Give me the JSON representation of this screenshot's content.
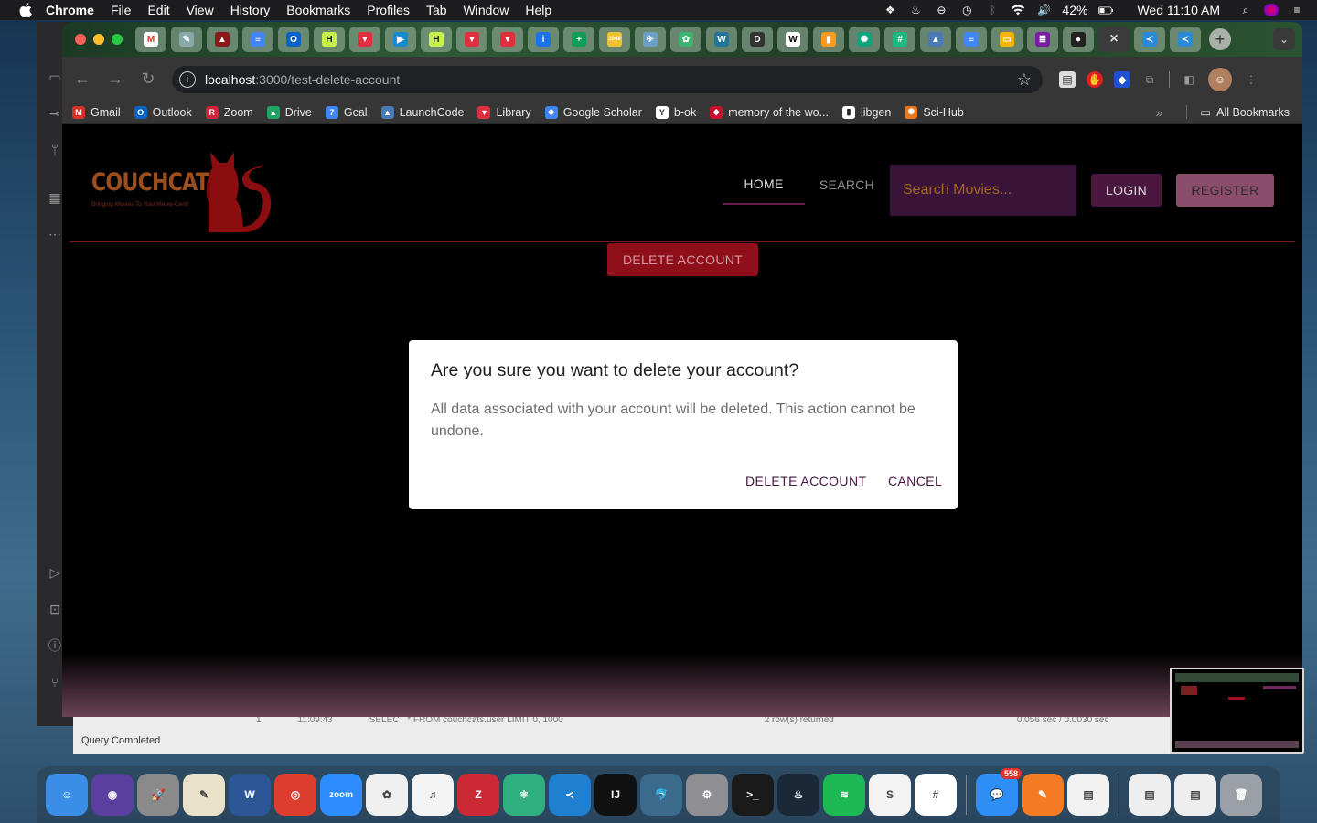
{
  "menubar": {
    "app": "Chrome",
    "items": [
      "File",
      "Edit",
      "View",
      "History",
      "Bookmarks",
      "Profiles",
      "Tab",
      "Window",
      "Help"
    ],
    "battery": "42%",
    "datetime": "Wed 11:10 AM"
  },
  "browser": {
    "url_host": "localhost",
    "url_path": ":3000/test-delete-account",
    "tabs": [
      {
        "icon": "gmail-icon",
        "color": "#ffffff",
        "glyph": "M",
        "fg": "#d93025"
      },
      {
        "icon": "pen-icon",
        "color": "#8aa",
        "glyph": "✎",
        "fg": "#fff"
      },
      {
        "icon": "app-icon",
        "color": "#8b1a1a",
        "glyph": "▲",
        "fg": "#fff"
      },
      {
        "icon": "docs-icon",
        "color": "#4285f4",
        "glyph": "≡",
        "fg": "#fff"
      },
      {
        "icon": "outlook-icon",
        "color": "#0a64c8",
        "glyph": "O",
        "fg": "#fff"
      },
      {
        "icon": "h-icon",
        "color": "#c6f24a",
        "glyph": "H",
        "fg": "#222"
      },
      {
        "icon": "red-app-icon",
        "color": "#e03040",
        "glyph": "▼",
        "fg": "#fff"
      },
      {
        "icon": "play-icon",
        "color": "#1a8ad0",
        "glyph": "▶",
        "fg": "#fff"
      },
      {
        "icon": "h-icon",
        "color": "#c6f24a",
        "glyph": "H",
        "fg": "#222"
      },
      {
        "icon": "red-app-icon",
        "color": "#e03040",
        "glyph": "▼",
        "fg": "#fff"
      },
      {
        "icon": "red-app-icon",
        "color": "#e03040",
        "glyph": "▼",
        "fg": "#fff"
      },
      {
        "icon": "info-icon",
        "color": "#1a73e8",
        "glyph": "i",
        "fg": "#fff"
      },
      {
        "icon": "sheets-plus-icon",
        "color": "#0f9d58",
        "glyph": "+",
        "fg": "#fff"
      },
      {
        "icon": "2048-icon",
        "color": "#edc22e",
        "glyph": "2048",
        "fg": "#fff"
      },
      {
        "icon": "bird-icon",
        "color": "#6aa0c8",
        "glyph": "✈",
        "fg": "#fff"
      },
      {
        "icon": "leaf-icon",
        "color": "#3cb371",
        "glyph": "✿",
        "fg": "#fff"
      },
      {
        "icon": "wordpress-icon",
        "color": "#21759b",
        "glyph": "W",
        "fg": "#fff"
      },
      {
        "icon": "d-icon",
        "color": "#333",
        "glyph": "D",
        "fg": "#fff"
      },
      {
        "icon": "wikipedia-icon",
        "color": "#fff",
        "glyph": "W",
        "fg": "#000"
      },
      {
        "icon": "orange-icon",
        "color": "#f59b23",
        "glyph": "▮",
        "fg": "#fff"
      },
      {
        "icon": "openai-icon",
        "color": "#10a37f",
        "glyph": "✺",
        "fg": "#fff"
      },
      {
        "icon": "grid-icon",
        "color": "#1eb980",
        "glyph": "#",
        "fg": "#fff"
      },
      {
        "icon": "launchcode-icon",
        "color": "#4a7ab5",
        "glyph": "▲",
        "fg": "#fff"
      },
      {
        "icon": "docs-icon",
        "color": "#4285f4",
        "glyph": "≡",
        "fg": "#fff"
      },
      {
        "icon": "slides-icon",
        "color": "#f4b400",
        "glyph": "▭",
        "fg": "#fff"
      },
      {
        "icon": "list-icon",
        "color": "#7b1fa2",
        "glyph": "≣",
        "fg": "#fff"
      },
      {
        "icon": "github-icon",
        "color": "#222",
        "glyph": "●",
        "fg": "#fff"
      }
    ],
    "active_tab_icon": "close-icon",
    "after_tabs": [
      {
        "icon": "vscode-icon",
        "color": "#2a8ad8",
        "glyph": "≺",
        "fg": "#fff"
      },
      {
        "icon": "vscode-icon",
        "color": "#2a8ad8",
        "glyph": "≺",
        "fg": "#fff"
      }
    ],
    "bookmarks": [
      {
        "label": "Gmail",
        "icon": "gmail-icon",
        "color": "#d93025",
        "glyph": "M"
      },
      {
        "label": "Outlook",
        "icon": "outlook-icon",
        "color": "#0a64c8",
        "glyph": "O"
      },
      {
        "label": "Zoom",
        "icon": "zoom-icon",
        "color": "#d0243a",
        "glyph": "R"
      },
      {
        "label": "Drive",
        "icon": "drive-icon",
        "color": "#1fa463",
        "glyph": "▲"
      },
      {
        "label": "Gcal",
        "icon": "calendar-icon",
        "color": "#4285f4",
        "glyph": "7"
      },
      {
        "label": "LaunchCode",
        "icon": "launchcode-icon",
        "color": "#4a7ab5",
        "glyph": "▲"
      },
      {
        "label": "Library",
        "icon": "library-icon",
        "color": "#e03040",
        "glyph": "▼"
      },
      {
        "label": "Google Scholar",
        "icon": "scholar-icon",
        "color": "#4285f4",
        "glyph": "◆"
      },
      {
        "label": "b-ok",
        "icon": "b-ok-icon",
        "color": "#ffffff",
        "glyph": "Y"
      },
      {
        "label": "memory of the wo...",
        "icon": "memory-icon",
        "color": "#c8102e",
        "glyph": "◆"
      },
      {
        "label": "libgen",
        "icon": "libgen-icon",
        "color": "#ffffff",
        "glyph": "▮"
      },
      {
        "label": "Sci-Hub",
        "icon": "scihub-icon",
        "color": "#e87820",
        "glyph": "✺"
      }
    ],
    "all_bookmarks": "All Bookmarks"
  },
  "site": {
    "logo_text": "COUCHCATS",
    "logo_tagline": "Bringing Movies To Your Meow-Cent!",
    "nav_home": "HOME",
    "nav_search": "SEARCH",
    "search_placeholder": "Search Movies...",
    "login": "LOGIN",
    "register": "REGISTER",
    "delete_account_button": "DELETE ACCOUNT"
  },
  "dialog": {
    "title": "Are you sure you want to delete your account?",
    "body": "All data associated with your account will be deleted. This action cannot be undone.",
    "confirm": "DELETE ACCOUNT",
    "cancel": "CANCEL"
  },
  "background_app": {
    "row_num": "1",
    "row_time": "11:09:43",
    "row_query": "SELECT * FROM couchcats.user LIMIT 0, 1000",
    "row_result": "2 row(s) returned",
    "row_duration": "0.056 sec / 0.0030 sec",
    "status": "Query Completed"
  },
  "dock": {
    "messages_badge": "558",
    "apps": [
      {
        "icon": "finder-icon",
        "color": "#3a8ee8",
        "glyph": "☺"
      },
      {
        "icon": "siri-icon",
        "color": "#5b3fa0",
        "glyph": "◉"
      },
      {
        "icon": "launchpad-icon",
        "color": "#8a8a8a",
        "glyph": "🚀"
      },
      {
        "icon": "preview-icon",
        "color": "#e9e2c8",
        "glyph": "✎"
      },
      {
        "icon": "word-icon",
        "color": "#2b5797",
        "glyph": "W"
      },
      {
        "icon": "chrome-icon",
        "color": "#dd3d2f",
        "glyph": "◎"
      },
      {
        "icon": "zoom-icon",
        "color": "#2d8cff",
        "glyph": "zoom"
      },
      {
        "icon": "photos-icon",
        "color": "#f0f0f0",
        "glyph": "✿"
      },
      {
        "icon": "music-icon",
        "color": "#f3f3f3",
        "glyph": "♫"
      },
      {
        "icon": "zotero-icon",
        "color": "#cc2936",
        "glyph": "Z"
      },
      {
        "icon": "atom-icon",
        "color": "#2fae7f",
        "glyph": "⚛"
      },
      {
        "icon": "vscode-icon",
        "color": "#1f7fd0",
        "glyph": "≺"
      },
      {
        "icon": "intellij-icon",
        "color": "#111",
        "glyph": "IJ"
      },
      {
        "icon": "mysql-icon",
        "color": "#3a6a8c",
        "glyph": "🐬"
      },
      {
        "icon": "system-preferences-icon",
        "color": "#8e8e93",
        "glyph": "⚙"
      },
      {
        "icon": "terminal-icon",
        "color": "#1a1a1a",
        "glyph": ">_"
      },
      {
        "icon": "steam-icon",
        "color": "#1b2838",
        "glyph": "♨"
      },
      {
        "icon": "spotify-icon",
        "color": "#1db954",
        "glyph": "≋"
      },
      {
        "icon": "scrivener-icon",
        "color": "#f3f3f3",
        "glyph": "S"
      },
      {
        "icon": "slack-icon",
        "color": "#ffffff",
        "glyph": "#"
      }
    ],
    "right_apps": [
      {
        "icon": "messages-icon",
        "color": "#2d8ef5",
        "glyph": "💬"
      },
      {
        "icon": "pencil-app-icon",
        "color": "#f27b24",
        "glyph": "✎"
      },
      {
        "icon": "notes-icon",
        "color": "#f2f2f2",
        "glyph": "▤"
      }
    ],
    "docs": [
      {
        "icon": "document-stack-icon",
        "color": "#eeeeee",
        "glyph": "▤"
      },
      {
        "icon": "document-stack-icon",
        "color": "#eeeeee",
        "glyph": "▤"
      },
      {
        "icon": "trash-icon",
        "color": "#9aa0a6",
        "glyph": "🗑"
      }
    ]
  }
}
